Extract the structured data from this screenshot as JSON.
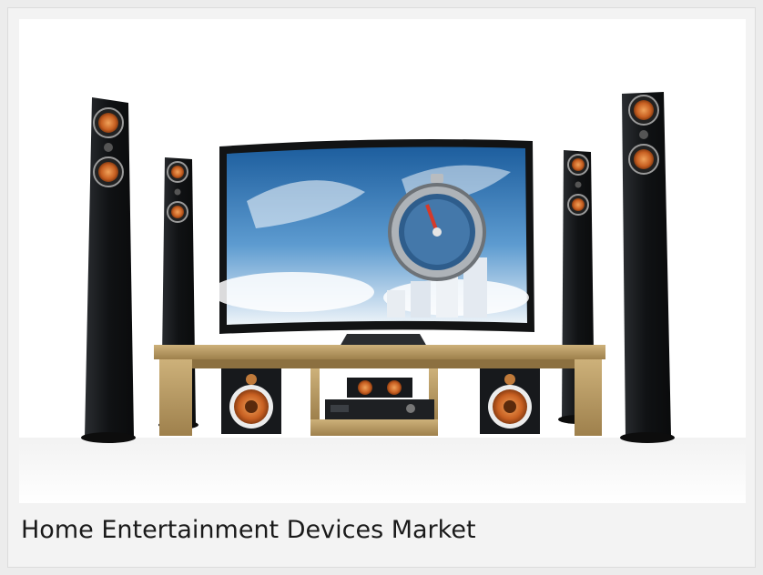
{
  "card": {
    "image_alt": "Home theater system with curved TV, tower speakers and TV stand",
    "caption": "Home Entertainment Devices Market"
  },
  "icons": {
    "speaker": "speaker-driver-icon",
    "tv": "curved-tv-icon",
    "stopwatch": "stopwatch-icon"
  },
  "colors": {
    "background": "#f3f3f3",
    "speaker_body": "#15171a",
    "speaker_driver": "#d26d2a",
    "wood": "#b89a62",
    "screen_sky": "#2d73b6",
    "text": "#1a1a1a"
  }
}
